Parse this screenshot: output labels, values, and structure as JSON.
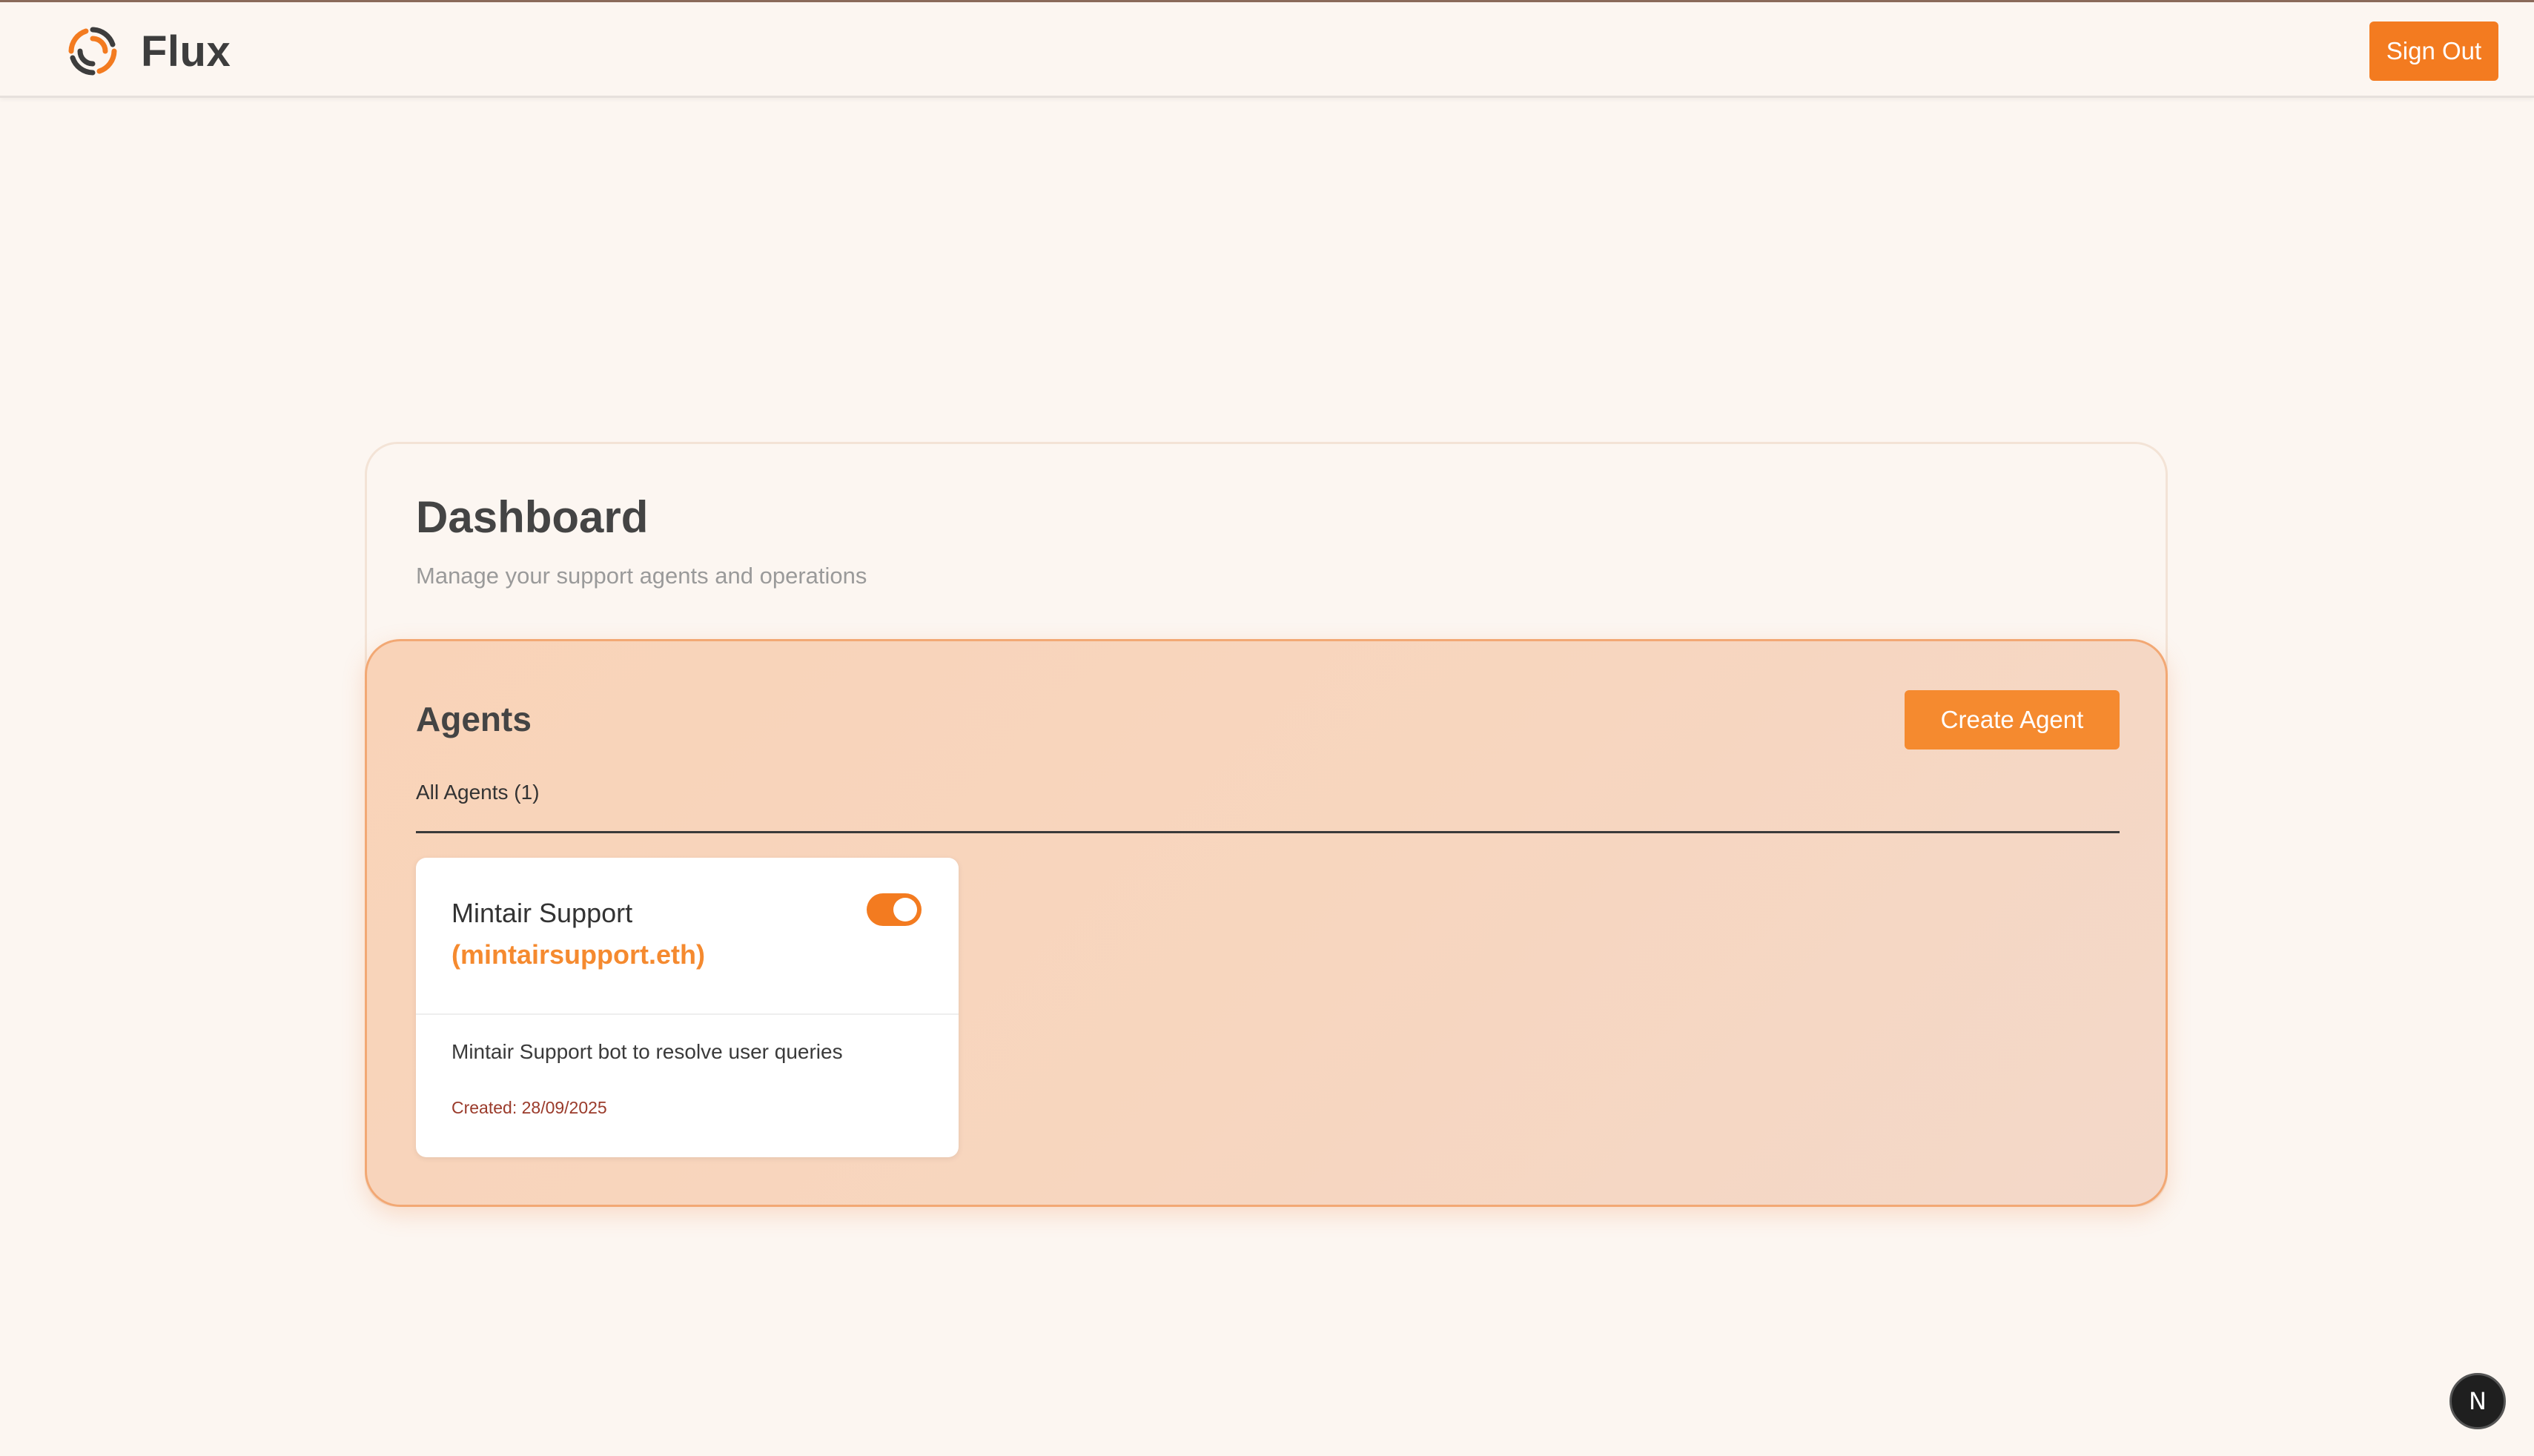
{
  "header": {
    "app_name": "Flux",
    "logo_icon": "flux-logo-icon",
    "sign_out_label": "Sign Out"
  },
  "dashboard": {
    "title": "Dashboard",
    "subtitle": "Manage your support agents and operations"
  },
  "agents": {
    "title": "Agents",
    "create_label": "Create Agent",
    "tab_all_label": "All Agents (1)",
    "items": [
      {
        "name": "Mintair Support",
        "ens": "(mintairsupport.eth)",
        "enabled": true,
        "description": "Mintair Support bot to resolve user queries",
        "created": "Created: 28/09/2025"
      }
    ]
  },
  "dev_badge": {
    "letter": "N"
  },
  "colors": {
    "accent": "#f37b20",
    "background": "#fcf6f1",
    "panel": "#f9d3b8"
  }
}
